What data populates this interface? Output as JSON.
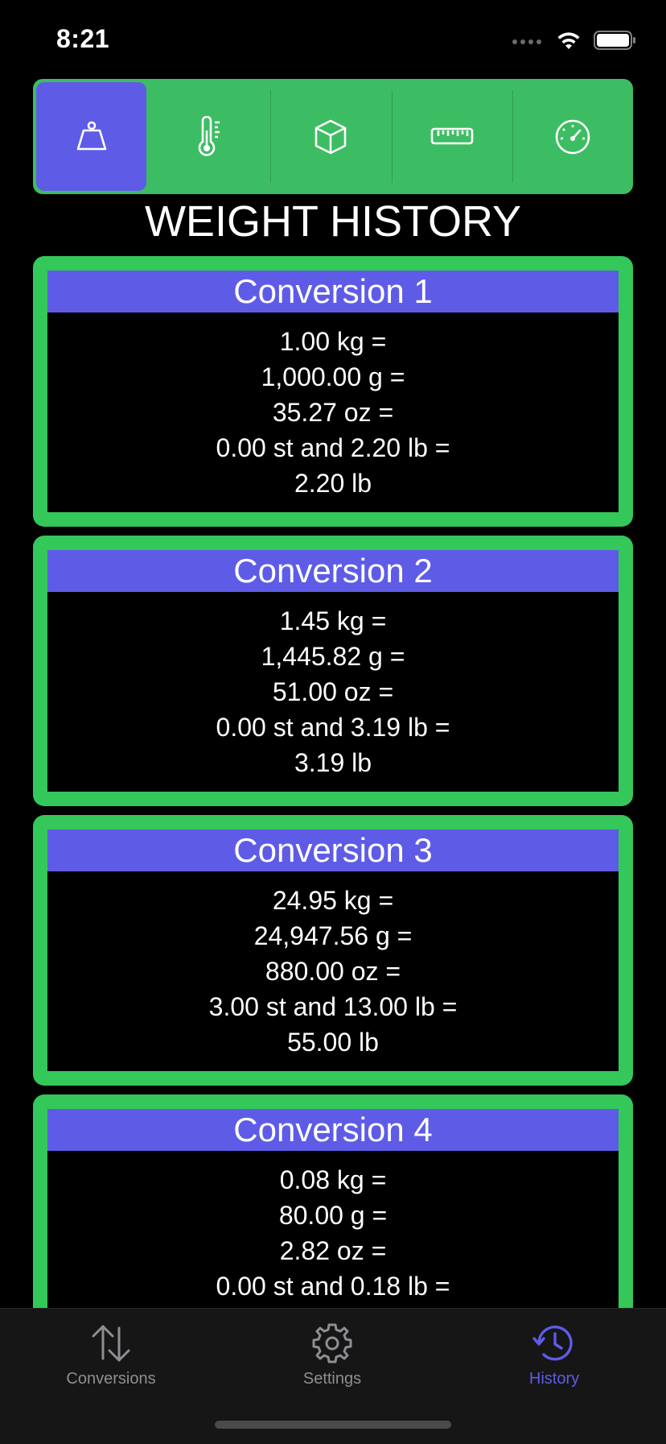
{
  "status_bar": {
    "time": "8:21"
  },
  "segmented_control": {
    "segments": [
      {
        "icon": "weight-icon",
        "selected": true
      },
      {
        "icon": "thermometer-icon",
        "selected": false
      },
      {
        "icon": "cube-icon",
        "selected": false
      },
      {
        "icon": "ruler-icon",
        "selected": false
      },
      {
        "icon": "speedometer-icon",
        "selected": false
      }
    ]
  },
  "page": {
    "title": "WEIGHT HISTORY"
  },
  "conversions": [
    {
      "title": "Conversion 1",
      "lines": [
        "1.00 kg =",
        "1,000.00 g =",
        "35.27 oz =",
        "0.00 st and 2.20 lb =",
        "2.20 lb"
      ]
    },
    {
      "title": "Conversion 2",
      "lines": [
        "1.45 kg =",
        "1,445.82 g =",
        "51.00 oz =",
        "0.00 st and 3.19 lb =",
        "3.19 lb"
      ]
    },
    {
      "title": "Conversion 3",
      "lines": [
        "24.95 kg =",
        "24,947.56 g =",
        "880.00 oz =",
        "3.00 st and 13.00 lb =",
        "55.00 lb"
      ]
    },
    {
      "title": "Conversion 4",
      "lines": [
        "0.08 kg =",
        "80.00 g =",
        "2.82 oz =",
        "0.00 st and 0.18 lb ="
      ]
    }
  ],
  "tab_bar": {
    "tabs": [
      {
        "label": "Conversions",
        "icon": "arrows-up-down-icon",
        "active": false
      },
      {
        "label": "Settings",
        "icon": "gear-icon",
        "active": false
      },
      {
        "label": "History",
        "icon": "history-clock-icon",
        "active": true
      }
    ]
  },
  "colors": {
    "accent": "#5e5ce6",
    "card_border": "#34c759",
    "segmented_bg": "#3dbd63",
    "background": "#000000",
    "tab_inactive": "#8e8e93"
  }
}
